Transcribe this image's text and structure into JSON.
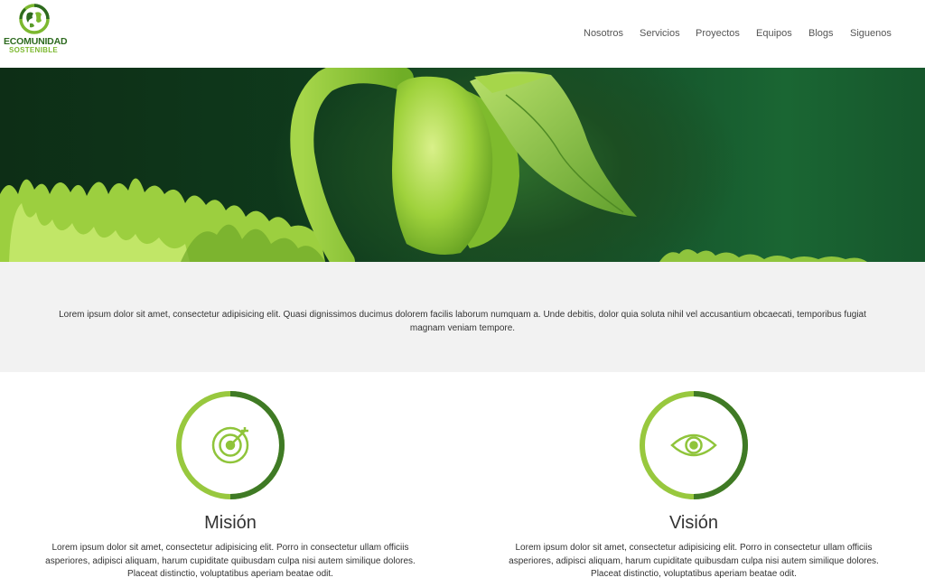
{
  "brand": {
    "line1": "ECOMUNIDAD",
    "line2": "SOSTENIBLE",
    "logo_icon": "globe-leaf-icon"
  },
  "nav": {
    "items": [
      {
        "label": "Nosotros"
      },
      {
        "label": "Servicios"
      },
      {
        "label": "Proyectos"
      },
      {
        "label": "Equipos"
      },
      {
        "label": "Blogs"
      },
      {
        "label": "Siguenos"
      }
    ]
  },
  "hero": {
    "image": "green-seedling-sprout-photo"
  },
  "intro": {
    "text": "Lorem ipsum dolor sit amet, consectetur adipisicing elit. Quasi dignissimos ducimus dolorem facilis laborum numquam a. Unde debitis, dolor quia soluta nihil vel accusantium obcaecati, temporibus fugiat magnam veniam tempore."
  },
  "features": [
    {
      "title": "Misión",
      "icon": "target-icon",
      "text": "Lorem ipsum dolor sit amet, consectetur adipisicing elit. Porro in consectetur ullam officiis asperiores, adipisci aliquam, harum cupiditate quibusdam culpa nisi autem similique dolores. Placeat distinctio, voluptatibus aperiam beatae odit."
    },
    {
      "title": "Visión",
      "icon": "eye-icon",
      "text": "Lorem ipsum dolor sit amet, consectetur adipisicing elit. Porro in consectetur ullam officiis asperiores, adipisci aliquam, harum cupiditate quibusdam culpa nisi autem similique dolores. Placeat distinctio, voluptatibus aperiam beatae odit."
    }
  ],
  "colors": {
    "brand_dark_green": "#2d6a1f",
    "brand_light_green": "#8fc43a",
    "ring_dark": "#3f7a25",
    "ring_light": "#98c83e",
    "band_gray": "#f2f2f2"
  }
}
